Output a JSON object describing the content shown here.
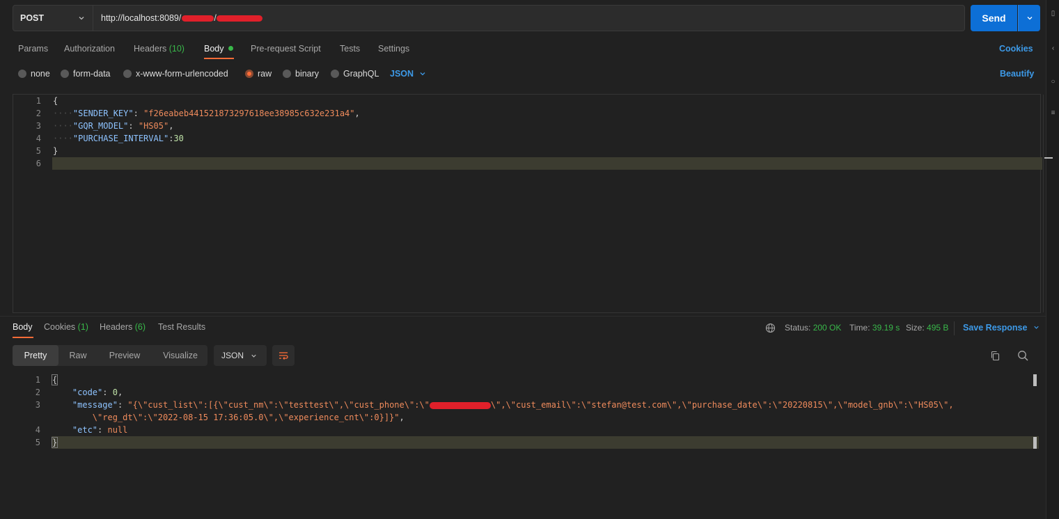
{
  "request": {
    "method": "POST",
    "url_prefix": "http://localhost:8089/",
    "url_mid": "/",
    "send_label": "Send"
  },
  "request_tabs": {
    "params": "Params",
    "authorization": "Authorization",
    "headers": "Headers",
    "headers_count": "(10)",
    "body": "Body",
    "pre_request": "Pre-request Script",
    "tests": "Tests",
    "settings": "Settings",
    "cookies": "Cookies"
  },
  "body_types": {
    "none": "none",
    "form_data": "form-data",
    "urlencoded": "x-www-form-urlencoded",
    "raw": "raw",
    "binary": "binary",
    "graphql": "GraphQL",
    "format": "JSON",
    "beautify": "Beautify",
    "selected": "raw"
  },
  "request_body": {
    "line_numbers": [
      "1",
      "2",
      "3",
      "4",
      "5",
      "6"
    ],
    "open_brace": "{",
    "close_brace": "}",
    "sender_key_name": "\"SENDER_KEY\"",
    "sender_key_value": "\"f26eabeb441521873297618ee38985c632e231a4\"",
    "gqr_model_name": "\"GQR_MODEL\"",
    "gqr_model_value": "\"HS05\"",
    "purchase_interval_name": "\"PURCHASE_INTERVAL\"",
    "purchase_interval_value": "30"
  },
  "response_tabs": {
    "body": "Body",
    "cookies": "Cookies",
    "cookies_count": "(1)",
    "headers": "Headers",
    "headers_count": "(6)",
    "test_results": "Test Results"
  },
  "response_status": {
    "status_label": "Status:",
    "status_value": "200 OK",
    "time_label": "Time:",
    "time_value": "39.19 s",
    "size_label": "Size:",
    "size_value": "495 B",
    "save_response": "Save Response"
  },
  "response_view": {
    "pretty": "Pretty",
    "raw": "Raw",
    "preview": "Preview",
    "visualize": "Visualize",
    "format": "JSON"
  },
  "response_body": {
    "line_numbers": [
      "1",
      "2",
      "3",
      "4",
      "5"
    ],
    "open_brace": "{",
    "close_brace": "}",
    "code_name": "\"code\"",
    "code_value": "0",
    "message_name": "\"message\"",
    "message_value_a": "\"{\\\"cust_list\\\":[{\\\"cust_nm\\\":\\\"testtest\\\",\\\"cust_phone\\\":\\\"",
    "message_value_b": "\\\",\\\"cust_email\\\":\\\"stefan@test.com\\\",\\\"purchase_date\\\":\\\"20220815\\\",\\\"model_gnb\\\":\\\"HS05\\\",",
    "message_value_c": "\\\"reg_dt\\\":\\\"2022-08-15 17:36:05.0\\\",\\\"experience_cnt\\\":0}]}\"",
    "etc_name": "\"etc\"",
    "etc_value": "null"
  },
  "colors": {
    "accent_orange": "#ff6c37",
    "send_blue": "#0d6fd6",
    "status_green": "#39b84a",
    "link_blue": "#3d9ae8"
  }
}
